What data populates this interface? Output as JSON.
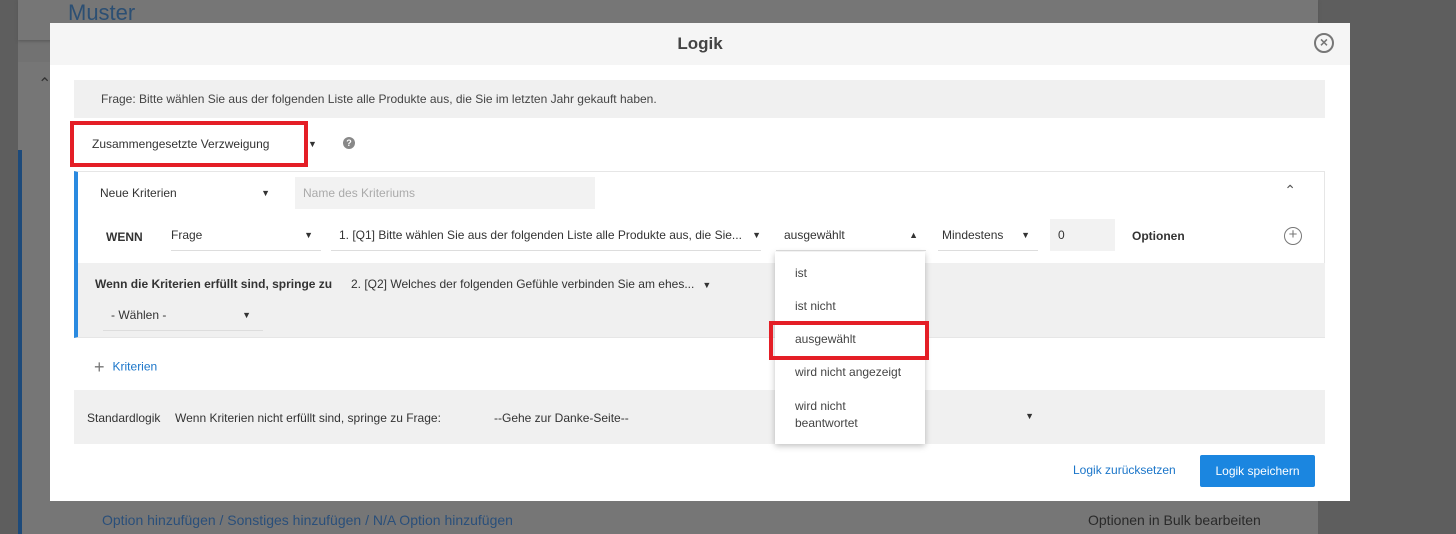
{
  "background": {
    "title": "Muster",
    "bottom_links": "Option hinzufügen / Sonstiges hinzufügen / N/A Option hinzufügen",
    "bulk_edit": "Optionen in Bulk bearbeiten"
  },
  "modal": {
    "title": "Logik",
    "question": "Frage: Bitte wählen Sie aus der folgenden Liste alle Produkte aus, die Sie im letzten Jahr gekauft haben.",
    "logic_type": "Zusammengesetzte Verzweigung",
    "criteria": {
      "name_select": "Neue Kriterien",
      "name_placeholder": "Name des Kriteriums",
      "if_label": "WENN",
      "source": "Frage",
      "question": "1. [Q1] Bitte wählen Sie aus der folgenden Liste alle Produkte aus, die Sie...",
      "operator": "ausgewählt",
      "quantifier": "Mindestens",
      "count": "0",
      "options_label": "Optionen",
      "jump_label": "Wenn die Kriterien erfüllt sind, springe zu",
      "jump_target": "2. [Q2]  Welches der folgenden Gefühle verbinden Sie am ehes...",
      "jump_choose": "- Wählen -"
    },
    "operator_options": [
      "ist",
      "ist nicht",
      "ausgewählt",
      "wird nicht angezeigt",
      "wird nicht beantwortet"
    ],
    "add_criteria": "Kriterien",
    "default_logic": {
      "label": "Standardlogik",
      "text": "Wenn Kriterien nicht erfüllt sind, springe zu Frage:",
      "value": "--Gehe zur Danke-Seite--"
    },
    "reset": "Logik zurücksetzen",
    "save": "Logik speichern"
  },
  "colors": {
    "accent": "#1b86e0",
    "highlight": "#e41e26"
  }
}
